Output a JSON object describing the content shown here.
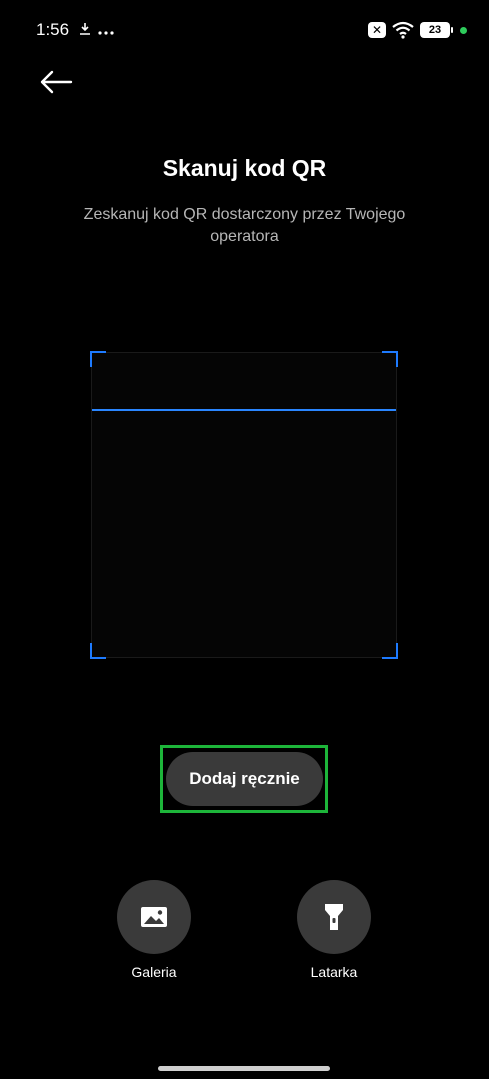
{
  "status_bar": {
    "time": "1:56",
    "left_icons": [
      "download-icon",
      "more-dots-icon"
    ],
    "right_icons": [
      "mute-icon",
      "wifi-icon",
      "battery-icon"
    ],
    "battery_level": "23",
    "accent_dot_color": "#2ecc5c"
  },
  "header": {
    "back_icon": "back-arrow-icon",
    "title": "Skanuj kod QR",
    "subtitle": "Zeskanuj kod QR dostarczony przez Twojego operatora"
  },
  "scanner": {
    "frame_color": "#1e7bff"
  },
  "manual": {
    "label": "Dodaj ręcznie",
    "highlight_color": "#1db53a"
  },
  "actions": [
    {
      "label": "Galeria",
      "icon": "gallery-icon"
    },
    {
      "label": "Latarka",
      "icon": "flashlight-icon"
    }
  ]
}
